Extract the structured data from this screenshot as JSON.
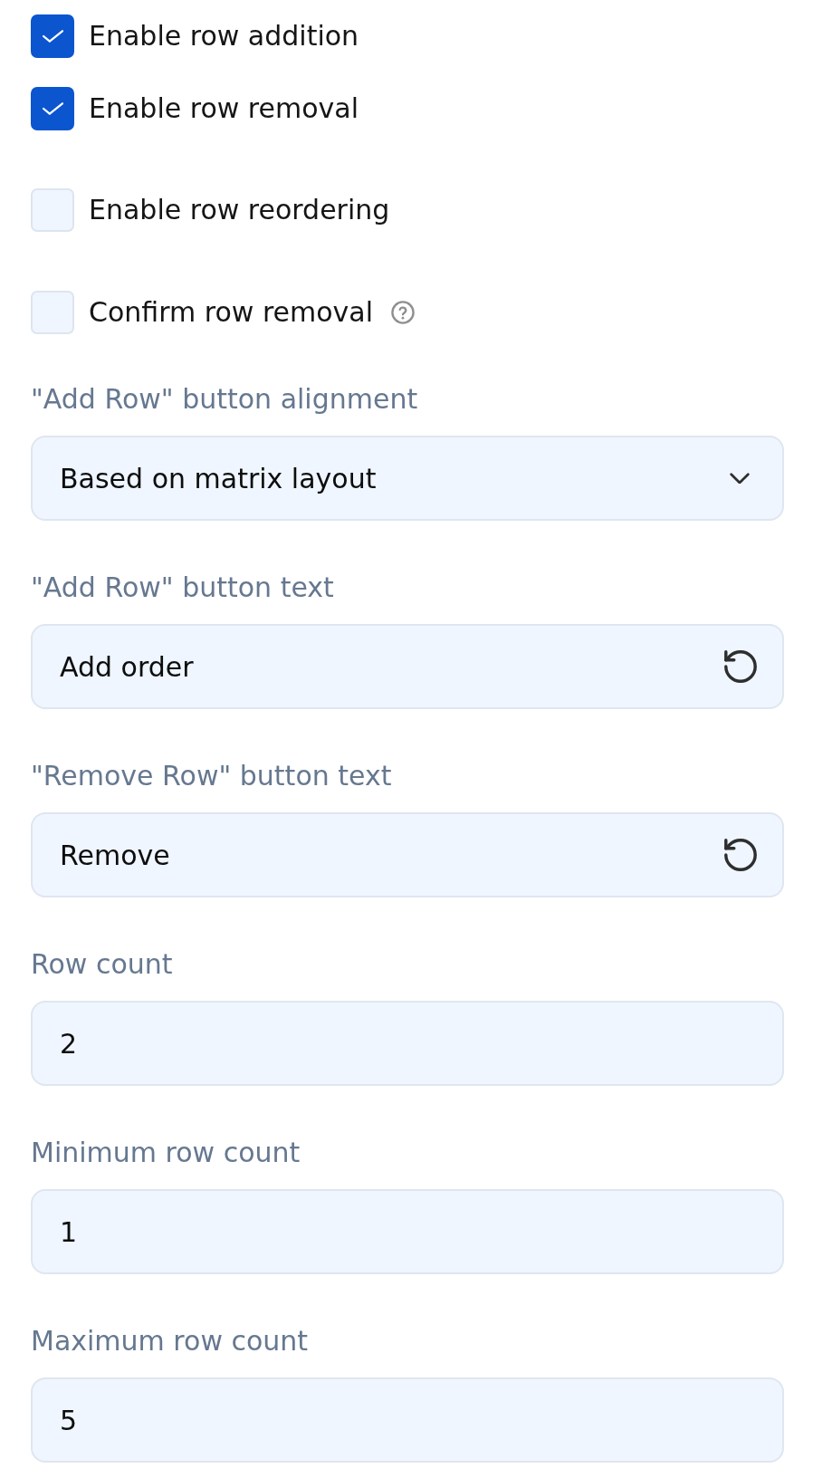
{
  "checkboxes": [
    {
      "label": "Enable row addition",
      "checked": true,
      "help": false
    },
    {
      "label": "Enable row removal",
      "checked": true,
      "help": false
    },
    {
      "label": "Enable row reordering",
      "checked": false,
      "help": false
    },
    {
      "label": "Confirm row removal",
      "checked": false,
      "help": true
    }
  ],
  "fields": [
    {
      "kind": "dropdown",
      "label": "\"Add Row\" button alignment",
      "value": "Based on matrix layout"
    },
    {
      "kind": "resettable",
      "label": "\"Add Row\" button text",
      "value": "Add order"
    },
    {
      "kind": "resettable",
      "label": "\"Remove Row\" button text",
      "value": "Remove"
    },
    {
      "kind": "number",
      "label": "Row count",
      "value": "2"
    },
    {
      "kind": "number",
      "label": "Minimum row count",
      "value": "1"
    },
    {
      "kind": "number",
      "label": "Maximum row count",
      "value": "5"
    }
  ]
}
